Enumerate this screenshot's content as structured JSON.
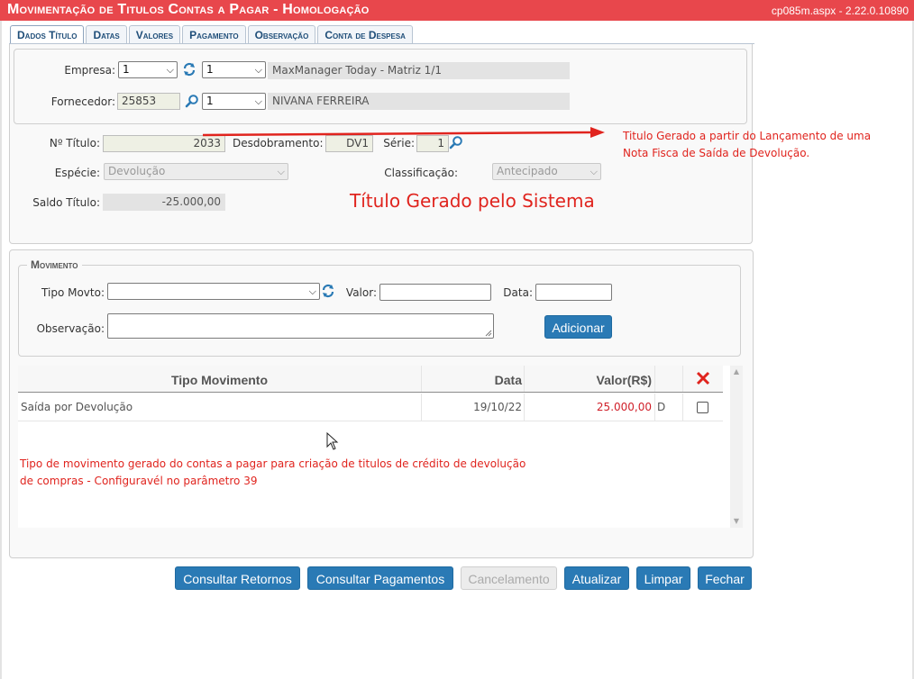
{
  "window": {
    "title": "Movimentação de Titulos Contas a Pagar  - Homologação",
    "version": "cp085m.aspx - 2.22.0.10890"
  },
  "tabs": [
    {
      "label": "Dados Título",
      "active": true
    },
    {
      "label": "Datas"
    },
    {
      "label": "Valores"
    },
    {
      "label": "Pagamento"
    },
    {
      "label": "Observação"
    },
    {
      "label": "Conta de Despesa"
    }
  ],
  "empresa": {
    "label": "Empresa:",
    "select_value": "1",
    "sub_select_value": "1",
    "name": "MaxManager Today - Matriz 1/1"
  },
  "fornecedor": {
    "label": "Fornecedor:",
    "code": "25853",
    "sub_select_value": "1",
    "name": "NIVANA FERREIRA"
  },
  "titulo": {
    "numero_label": "Nº Título:",
    "numero_value": "2033",
    "desdobramento_label": "Desdobramento:",
    "desdobramento_value": "DV1",
    "serie_label": "Série:",
    "serie_value": "1",
    "especie_label": "Espécie:",
    "especie_value": "Devolução",
    "classificacao_label": "Classificação:",
    "classificacao_value": "Antecipado",
    "saldo_label": "Saldo Título:",
    "saldo_value": "-25.000,00"
  },
  "annotations": {
    "arrow_note_line1": "Titulo Gerado a partir do Lançamento de uma",
    "arrow_note_line2": "Nota Fisca de Saída de Devolução.",
    "big_note": "Título Gerado pelo Sistema",
    "grid_note_line1": "Tipo de movimento gerado do contas a pagar para criação de titulos de crédito de devolução",
    "grid_note_line2": "de compras - Configuravél no parâmetro 39",
    "color": "#e0241e"
  },
  "movimento": {
    "legend": "Movimento",
    "tipo_label": "Tipo Movto:",
    "tipo_value": "",
    "valor_label": "Valor:",
    "valor_value": "",
    "data_label": "Data:",
    "data_value": "",
    "obs_label": "Observação:",
    "obs_value": "",
    "add_button": "Adicionar"
  },
  "grid": {
    "columns": [
      "Tipo Movimento",
      "Data",
      "Valor(R$)",
      ""
    ],
    "rows": [
      {
        "tipo": "Saída por Devolução",
        "data": "19/10/22",
        "valor": "25.000,00",
        "dc": "D",
        "checked": false
      }
    ],
    "value_color": "#d0202a"
  },
  "buttons": {
    "consultar_retornos": "Consultar Retornos",
    "consultar_pagamentos": "Consultar Pagamentos",
    "cancelamento": "Cancelamento",
    "atualizar": "Atualizar",
    "limpar": "Limpar",
    "fechar": "Fechar"
  },
  "colors": {
    "titlebar": "#e8474c",
    "button": "#2a7ab5",
    "tab_text": "#1f4e79"
  }
}
